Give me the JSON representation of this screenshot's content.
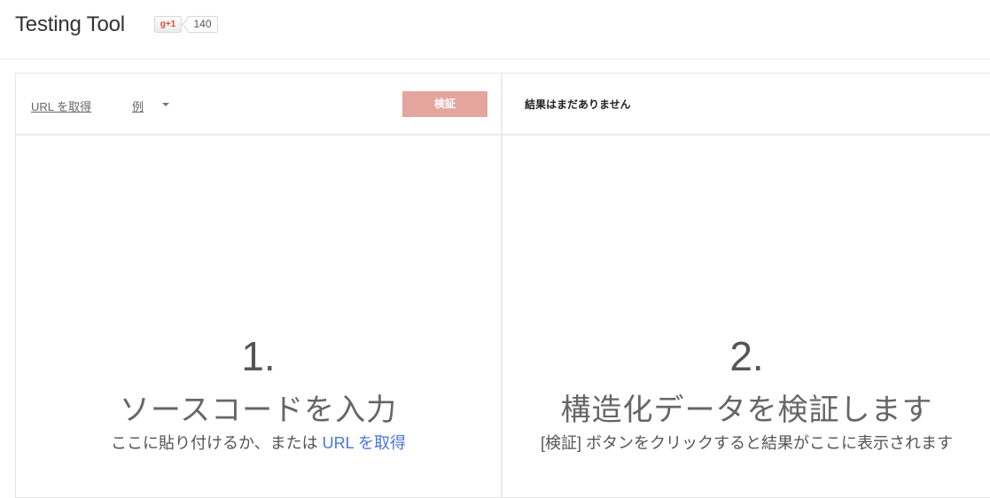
{
  "header": {
    "title": "Testing Tool",
    "gplus_label": "g+1",
    "gplus_count": "140"
  },
  "toolbar": {
    "fetch_url": "URL を取得",
    "examples": "例",
    "validate": "検証"
  },
  "results": {
    "empty_message": "結果はまだありません"
  },
  "steps": [
    {
      "number": "1.",
      "title": "ソースコードを入力",
      "desc_prefix": "ここに貼り付けるか、または ",
      "desc_link": "URL を取得"
    },
    {
      "number": "2.",
      "title": "構造化データを検証します",
      "desc": "[検証] ボタンをクリックすると結果がここに表示されます"
    }
  ],
  "colors": {
    "validate_button": "#e4a59d",
    "link": "#4a76d8",
    "gplus": "#dd4b39"
  }
}
